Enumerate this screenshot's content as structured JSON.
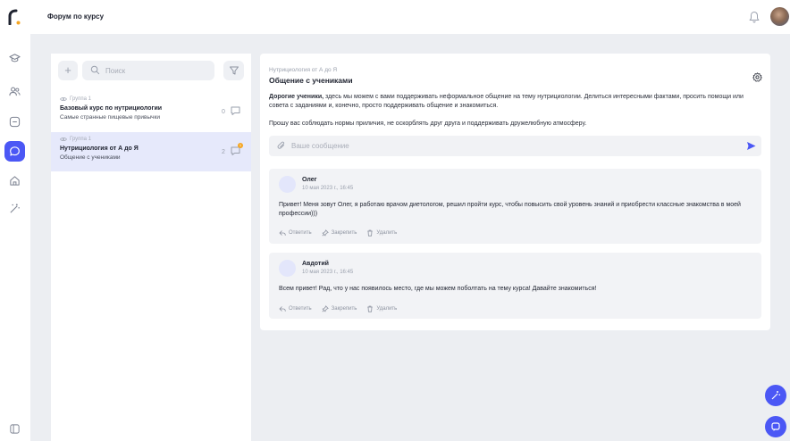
{
  "app": {
    "title": "Форум по курсу"
  },
  "list": {
    "search_placeholder": "Поиск",
    "chats": [
      {
        "group": "Группа 1",
        "title": "Базовый курс по нутрициологии",
        "subtitle": "Самые странные пищевые привычки",
        "count": "0",
        "unread": false
      },
      {
        "group": "Группа 1",
        "title": "Нутрициология от А до Я",
        "subtitle": "Общение с учениками",
        "count": "2",
        "unread": true,
        "badge": "1"
      }
    ]
  },
  "topic": {
    "breadcrumb": "Нутрициология от А до Я",
    "title": "Общение с учениками",
    "desc_bold": "Дорогие ученики,",
    "desc_rest": " здесь мы можем с вами поддерживать неформальное общение на тему нутрициологии. Делиться интересными фактами, просить помощи или совета с заданиями и, конечно, просто поддерживать общение и знакомиться.",
    "rules": "Прошу вас соблюдать нормы приличия, не оскорблять друг друга и поддерживать дружелюбную атмосферу.",
    "composer_placeholder": "Ваше сообщение"
  },
  "messages": [
    {
      "author": "Олег",
      "date": "10 мая 2023 г., 16:45",
      "text": "Привет! Меня зовут Олег, я работаю врачом диетологом, решил пройти курс, чтобы повысить свой уровень знаний и приобрести классные знакомства в моей профессии)))"
    },
    {
      "author": "Авдотий",
      "date": "10 мая 2023 г., 16:45",
      "text": "Всем привет! Рад, что у нас появилось место, где мы можем поболтать на тему курса! Давайте знакомиться!"
    }
  ],
  "actions": {
    "reply": "Ответить",
    "pin": "Закрепить",
    "delete": "Удалить"
  },
  "colors": {
    "accent": "#4b57f5",
    "badge": "#f5a623",
    "active_row": "#e6e9fb"
  }
}
